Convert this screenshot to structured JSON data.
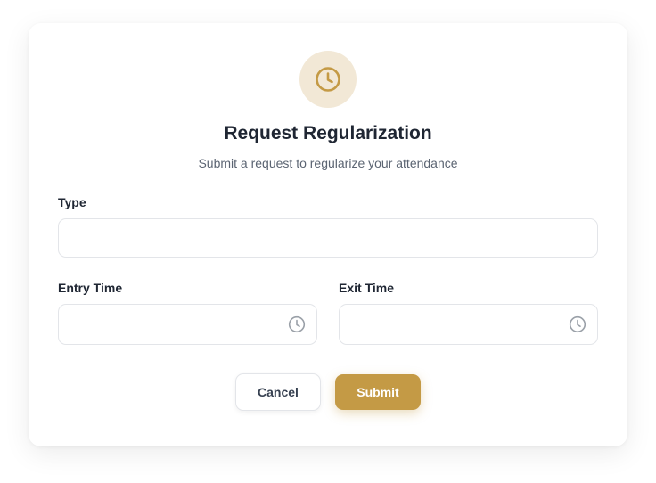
{
  "dialog": {
    "icon": "clock-icon",
    "title": "Request Regularization",
    "subtitle": "Submit a request to regularize your attendance"
  },
  "form": {
    "type": {
      "label": "Type",
      "value": "",
      "placeholder": ""
    },
    "entry_time": {
      "label": "Entry Time",
      "value": "",
      "placeholder": "",
      "icon": "clock-icon"
    },
    "exit_time": {
      "label": "Exit Time",
      "value": "",
      "placeholder": "",
      "icon": "clock-icon"
    }
  },
  "actions": {
    "cancel_label": "Cancel",
    "submit_label": "Submit"
  },
  "colors": {
    "accent": "#c49a45",
    "accent_light": "#f2e8d6",
    "text_primary": "#1f2633",
    "text_secondary": "#5b6472",
    "border": "#e3e5e9"
  }
}
